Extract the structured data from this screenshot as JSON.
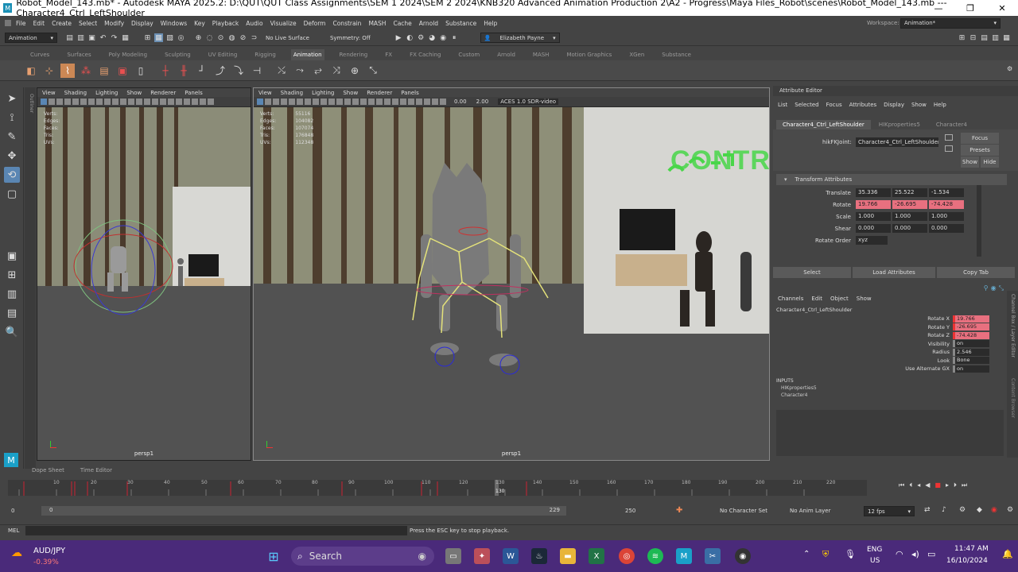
{
  "window": {
    "title": "Robot_Model_143.mb* - Autodesk MAYA 2025.2: D:\\QUT\\QUT Class Assignments\\SEM 1 2024\\SEM 2 2024\\KNB320 Advanced Animation Production 2\\A2 - Progress\\Maya Files_Robot\\scenes\\Robot_Model_143.mb   ---   Character4_Ctrl_LeftShoulder",
    "minimize": "—",
    "maximize": "❐",
    "close": "✕"
  },
  "menubar": {
    "items": [
      "File",
      "Edit",
      "Create",
      "Select",
      "Modify",
      "Display",
      "Windows",
      "Key",
      "Playback",
      "Audio",
      "Visualize",
      "Deform",
      "Constrain",
      "MASH",
      "Cache",
      "Arnold",
      "Substance",
      "Help"
    ],
    "workspace_label": "Workspace:",
    "workspace_value": "Animation*"
  },
  "statusline": {
    "mode": "Animation",
    "live_surface": "No Live Surface",
    "symmetry": "Symmetry: Off",
    "user": "Elizabeth Payne"
  },
  "shelf_tabs": [
    "Curves",
    "Surfaces",
    "Poly Modeling",
    "Sculpting",
    "UV Editing",
    "Rigging",
    "Animation",
    "Rendering",
    "FX",
    "FX Caching",
    "Custom",
    "Arnold",
    "MASH",
    "Motion Graphics",
    "XGen",
    "Substance"
  ],
  "shelf_active": "Animation",
  "viewport_menu": [
    "View",
    "Shading",
    "Lighting",
    "Show",
    "Renderer",
    "Panels"
  ],
  "left_viewport": {
    "hud_labels": [
      "Verts:",
      "Edges:",
      "Faces:",
      "Tris:",
      "UVs:"
    ],
    "camera": "persp1"
  },
  "main_viewport": {
    "hud_labels": [
      "Verts:",
      "Edges:",
      "Faces:",
      "Tris:",
      "UVs:"
    ],
    "hud_values": [
      "55116",
      "104082",
      "107074",
      "176848",
      "112348"
    ],
    "exposure": "0.00",
    "gamma": "2.00",
    "colorspace": "ACES 1.0 SDR-video",
    "camera": "persp1",
    "wall_text": "CONTR"
  },
  "outliner_label": "Outliner",
  "attribute_editor": {
    "title": "Attribute Editor",
    "menu": [
      "List",
      "Selected",
      "Focus",
      "Attributes",
      "Display",
      "Show",
      "Help"
    ],
    "tabs": [
      "Character4_Ctrl_LeftShoulder",
      "HIKproperties5",
      "Character4"
    ],
    "node_label": "hikFKJoint:",
    "node_value": "Character4_Ctrl_LeftShoulder",
    "focus_btn": "Focus",
    "presets_btn": "Presets",
    "show_btn": "Show",
    "hide_btn": "Hide",
    "section": "Transform Attributes",
    "rows": [
      {
        "label": "Translate",
        "values": [
          "35.336",
          "25.522",
          "-1.534"
        ]
      },
      {
        "label": "Rotate",
        "values": [
          "19.766",
          "-26.695",
          "-74.428"
        ]
      },
      {
        "label": "Scale",
        "values": [
          "1.000",
          "1.000",
          "1.000"
        ]
      },
      {
        "label": "Shear",
        "values": [
          "0.000",
          "0.000",
          "0.000"
        ]
      }
    ],
    "rotate_order_label": "Rotate Order",
    "rotate_order_value": "xyz",
    "buttons": [
      "Select",
      "Load Attributes",
      "Copy Tab"
    ]
  },
  "channel_box": {
    "menu": [
      "Channels",
      "Edit",
      "Object",
      "Show"
    ],
    "node": "Character4_Ctrl_LeftShoulder",
    "rows": [
      {
        "label": "Rotate X",
        "value": "19.766",
        "keyed": true
      },
      {
        "label": "Rotate Y",
        "value": "-26.695",
        "keyed": true
      },
      {
        "label": "Rotate Z",
        "value": "-74.428",
        "keyed": true
      },
      {
        "label": "Visibility",
        "value": "on",
        "keyed": false
      },
      {
        "label": "Radius",
        "value": "2.546",
        "keyed": false
      },
      {
        "label": "Look",
        "value": "Bone",
        "keyed": false
      },
      {
        "label": "Use Alternate GX",
        "value": "on",
        "keyed": false
      }
    ],
    "inputs_label": "INPUTS",
    "inputs": [
      "HIKproperties5",
      "Character4"
    ],
    "side_tabs": [
      "Channel Box / Layer Editor",
      "Content Browser"
    ]
  },
  "timeline": {
    "tabs": [
      "Dope Sheet",
      "Time Editor"
    ],
    "ticks": [
      "10",
      "20",
      "30",
      "40",
      "50",
      "60",
      "70",
      "80",
      "90",
      "100",
      "110",
      "120",
      "130",
      "140",
      "150",
      "160",
      "170",
      "180",
      "190",
      "200",
      "210",
      "220"
    ],
    "current_frame": "130"
  },
  "range": {
    "start": "0",
    "inner_start": "0",
    "inner_end": "229",
    "end": "250",
    "character_set": "No Character Set",
    "anim_layer": "No Anim Layer",
    "fps": "12 fps"
  },
  "cmdline": {
    "label": "MEL",
    "help": "Press the ESC key to stop playback."
  },
  "taskbar": {
    "ticker": "AUD/JPY",
    "change": "-0.39%",
    "search": "Search",
    "lang1": "ENG",
    "lang2": "US",
    "time": "11:47 AM",
    "date": "16/10/2024"
  }
}
